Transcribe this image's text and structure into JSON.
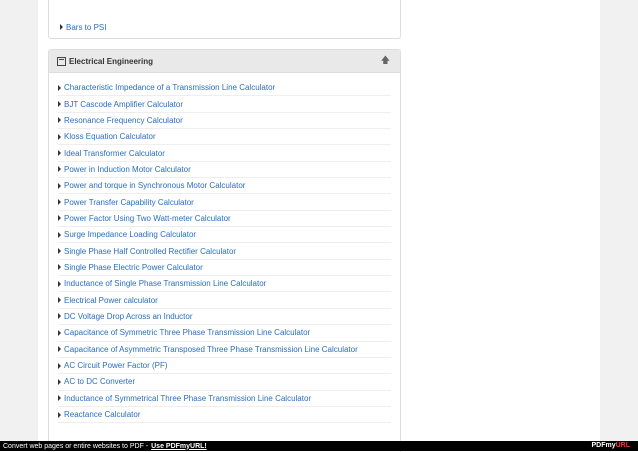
{
  "top_panel": {
    "item": "Bars to PSI"
  },
  "section": {
    "title": "Electrical Engineering",
    "items": [
      "Characteristic Impedance of a Transmission Line Calculator",
      "BJT Cascode Amplifier Calculator",
      "Resonance Frequency Calculator",
      "Kloss Equation Calculator",
      "Ideal Transformer Calculator",
      "Power in Induction Motor Calculator",
      "Power and torque in Synchronous Motor Calculator",
      "Power Transfer Capability Calculator",
      "Power Factor Using Two Watt-meter Calculator",
      "Surge Impedance Loading Calculator",
      "Single Phase Half Controlled Rectifier Calculator",
      "Single Phase Electric Power Calculator",
      "Inductance of Single Phase Transmission Line Calculator",
      "Electrical Power calculator",
      "DC Voltage Drop Across an Inductor",
      "Capacitance of Symmetric Three Phase Transmission Line Calculator",
      "Capacitance of Asymmetric Transposed Three Phase Transmission Line Calculator",
      "AC Circuit Power Factor (PF)",
      "AC to DC Converter",
      "Inductance of Symmetrical Three Phase Transmission Line Calculator",
      "Reactance Calculator"
    ]
  },
  "footer": {
    "text": "Convert web pages or entire websites to PDF -",
    "link": "Use PDFmyURL!",
    "logo_main": "PDFmy",
    "logo_accent": "URL"
  },
  "colors": {
    "link": "#2a6ebb",
    "heading_bg": "#e9e9e9",
    "footer_bg": "#000000"
  },
  "icons": {
    "heading": "calculator-icon",
    "collapse": "arrow-up-icon",
    "item": "caret-right-icon"
  }
}
